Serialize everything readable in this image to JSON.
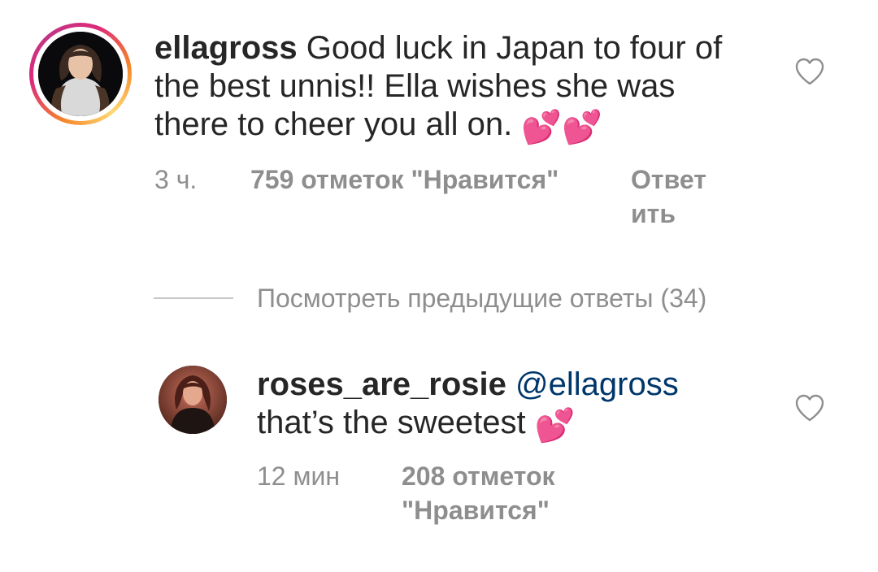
{
  "comments": [
    {
      "username": "ellagross",
      "text": " Good luck in Japan to four of the best unnis!! Ella wishes she was there to cheer you all on. ",
      "emoji": "💕💕",
      "time": "3 ч.",
      "likes": "759 отметок \"Нравится\"",
      "reply_label": "Ответить",
      "reply_line1": "Ответ",
      "reply_line2": "ить",
      "like_icon": "heart-outline-icon",
      "avatar_ring_colors": [
        "#f58529",
        "#dd2a7b",
        "#feda77"
      ]
    },
    {
      "username": "roses_are_rosie",
      "mention": "@ellagross",
      "text": "that’s the sweetest ",
      "emoji": "💕",
      "time": "12 мин",
      "likes_line1": "208 отметок",
      "likes_line2": "\"Нравится\"",
      "like_icon": "heart-outline-icon"
    }
  ],
  "view_replies": "Посмотреть предыдущие ответы (34)",
  "colors": {
    "text": "#262626",
    "secondary": "#8e8e8e",
    "mention": "#00376b",
    "divider": "#c7c7c7"
  }
}
